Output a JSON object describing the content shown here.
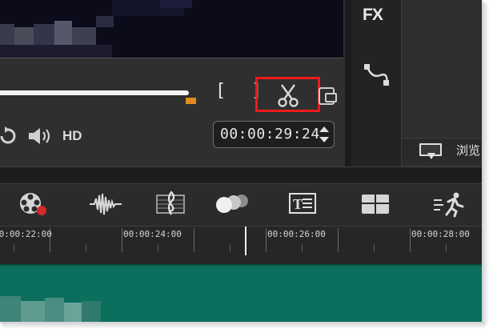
{
  "preview": {
    "mark_in": "[",
    "mark_out": "]",
    "hd_label": "HD",
    "timecode": "00:00:29:24",
    "progress": 0.55
  },
  "side_panel": {
    "fx_label": "FX",
    "browse_label": "浏览"
  },
  "timeline": {
    "ruler_labels": [
      "00:00:22:00",
      "00:00:24:00",
      "00:00:26:00",
      "00:00:28:00"
    ],
    "toolbar_icons": [
      "film-reel-icon",
      "audio-wave-icon",
      "music-clef-icon",
      "transition-balls-icon",
      "title-icon",
      "overlay-grid-icon",
      "motion-runner-icon"
    ]
  },
  "colors": {
    "highlight": "#ee1b1b",
    "scrub_handle": "#e28a1d",
    "track": "#0c6f5e"
  }
}
